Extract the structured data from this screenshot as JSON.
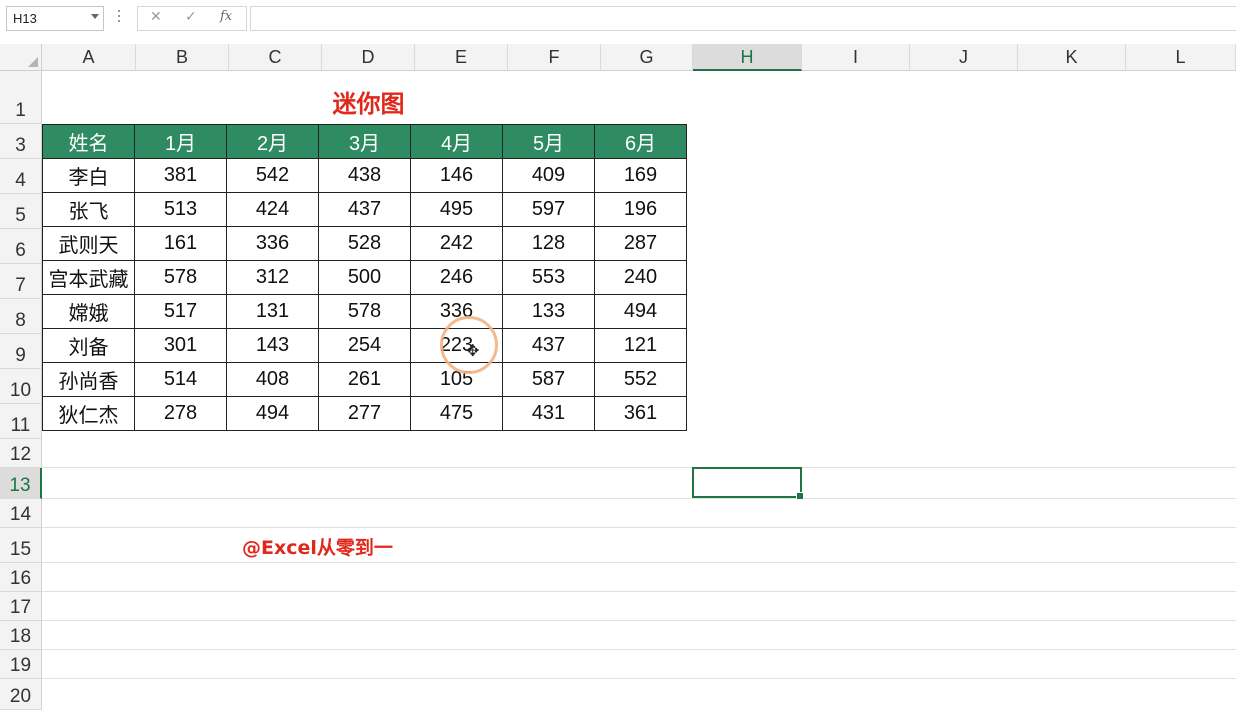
{
  "name_box": {
    "value": "H13"
  },
  "formula_bar": {
    "cancel": "✕",
    "enter": "✓",
    "fx": "fx",
    "value": ""
  },
  "columns": [
    "A",
    "B",
    "C",
    "D",
    "E",
    "F",
    "G",
    "H",
    "I",
    "J",
    "K",
    "L"
  ],
  "rows": [
    "1",
    "3",
    "4",
    "5",
    "6",
    "7",
    "8",
    "9",
    "10",
    "11",
    "12",
    "13",
    "14",
    "15",
    "16",
    "17",
    "18",
    "19",
    "20"
  ],
  "selected_column": "H",
  "selected_row": "13",
  "sheet": {
    "title": "迷你图",
    "table": {
      "headers": [
        "姓名",
        "1月",
        "2月",
        "3月",
        "4月",
        "5月",
        "6月"
      ],
      "rows": [
        [
          "李白",
          "381",
          "542",
          "438",
          "146",
          "409",
          "169"
        ],
        [
          "张飞",
          "513",
          "424",
          "437",
          "495",
          "597",
          "196"
        ],
        [
          "武则天",
          "161",
          "336",
          "528",
          "242",
          "128",
          "287"
        ],
        [
          "宫本武藏",
          "578",
          "312",
          "500",
          "246",
          "553",
          "240"
        ],
        [
          "嫦娥",
          "517",
          "131",
          "578",
          "336",
          "133",
          "494"
        ],
        [
          "刘备",
          "301",
          "143",
          "254",
          "223",
          "437",
          "121"
        ],
        [
          "孙尚香",
          "514",
          "408",
          "261",
          "105",
          "587",
          "552"
        ],
        [
          "狄仁杰",
          "278",
          "494",
          "277",
          "475",
          "431",
          "361"
        ]
      ]
    },
    "watermark": "@Excel从零到一"
  },
  "colors": {
    "header_green": "#2e8b62",
    "accent_red": "#e0291d",
    "selection_green": "#217346"
  }
}
